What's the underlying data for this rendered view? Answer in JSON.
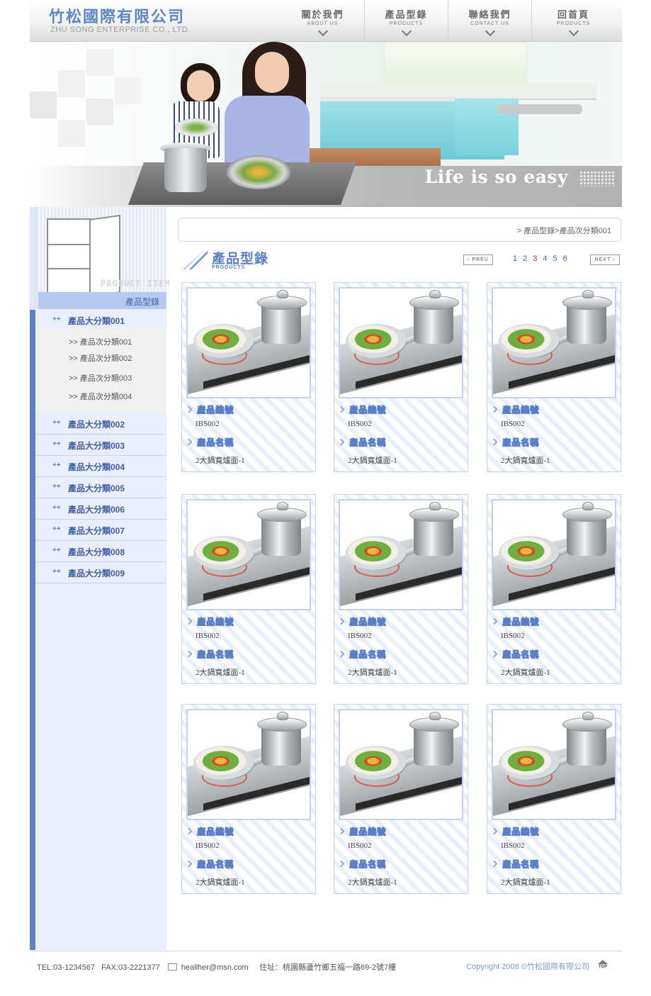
{
  "header": {
    "brand_cn": "竹松國際有限公司",
    "brand_en": "ZHU SONG ENTERPRISE CO., LTD.",
    "nav": [
      {
        "label": "關於我們",
        "sub": "ABOUT US"
      },
      {
        "label": "產品型錄",
        "sub": "PRODUCTS"
      },
      {
        "label": "聯絡我們",
        "sub": "CONTACT US"
      },
      {
        "label": "回首頁",
        "sub": "PRODUCTS"
      }
    ]
  },
  "banner": {
    "tagline": "Life is so easy"
  },
  "sidebar": {
    "header_en": "PRODUCT ITEM",
    "header_cn": "產品型錄",
    "categories": [
      {
        "label": "產品大分類001"
      },
      {
        "label": "產品大分類002"
      },
      {
        "label": "產品大分類003"
      },
      {
        "label": "產品大分類004"
      },
      {
        "label": "產品大分類005"
      },
      {
        "label": "產品大分類006"
      },
      {
        "label": "產品大分類007"
      },
      {
        "label": "產品大分類008"
      },
      {
        "label": "產品大分類009"
      }
    ],
    "subcategories": [
      {
        "label": ">> 產品次分類001"
      },
      {
        "label": ">> 產品次分類002"
      },
      {
        "label": ">> 產品次分類003"
      },
      {
        "label": ">> 產品次分類004"
      }
    ],
    "bullet": "++"
  },
  "breadcrumb": "> 產品型錄>產品次分類001",
  "section": {
    "title_cn": "產品型錄",
    "title_en": "PRODUCTS"
  },
  "pagination": {
    "prev": "‹ PREU",
    "next": "NEXT ›",
    "pages": [
      "1",
      "2",
      "3",
      "4",
      "5",
      "6"
    ],
    "current": "3"
  },
  "product_labels": {
    "code": "產品編號",
    "name": "產品名稱"
  },
  "products": [
    {
      "code": "IBS002",
      "name": "2大鍋寬爐面-1"
    },
    {
      "code": "IBS002",
      "name": "2大鍋寬爐面-1"
    },
    {
      "code": "IBS002",
      "name": "2大鍋寬爐面-1"
    },
    {
      "code": "IBS002",
      "name": "2大鍋寬爐面-1"
    },
    {
      "code": "IBS002",
      "name": "2大鍋寬爐面-1"
    },
    {
      "code": "IBS002",
      "name": "2大鍋寬爐面-1"
    },
    {
      "code": "IBS002",
      "name": "2大鍋寬爐面-1"
    },
    {
      "code": "IBS002",
      "name": "2大鍋寬爐面-1"
    },
    {
      "code": "IBS002",
      "name": "2大鍋寬爐面-1"
    }
  ],
  "footer": {
    "tel": "TEL:03-1234567",
    "fax": "FAX:03-2221377",
    "email": "heallher@msn.com",
    "address": "住址：桃園縣蘆竹鄉五福一路69-2號7樓",
    "copyright": "Copyright  2008  ©竹松國際有限公司",
    "top_label": "TOP"
  },
  "colors": {
    "accent": "#5d80c6",
    "sidebar_bg": "#e9eefa",
    "sidebar_stripe": "#5f7fc8",
    "current_page": "#cf2a2a"
  }
}
